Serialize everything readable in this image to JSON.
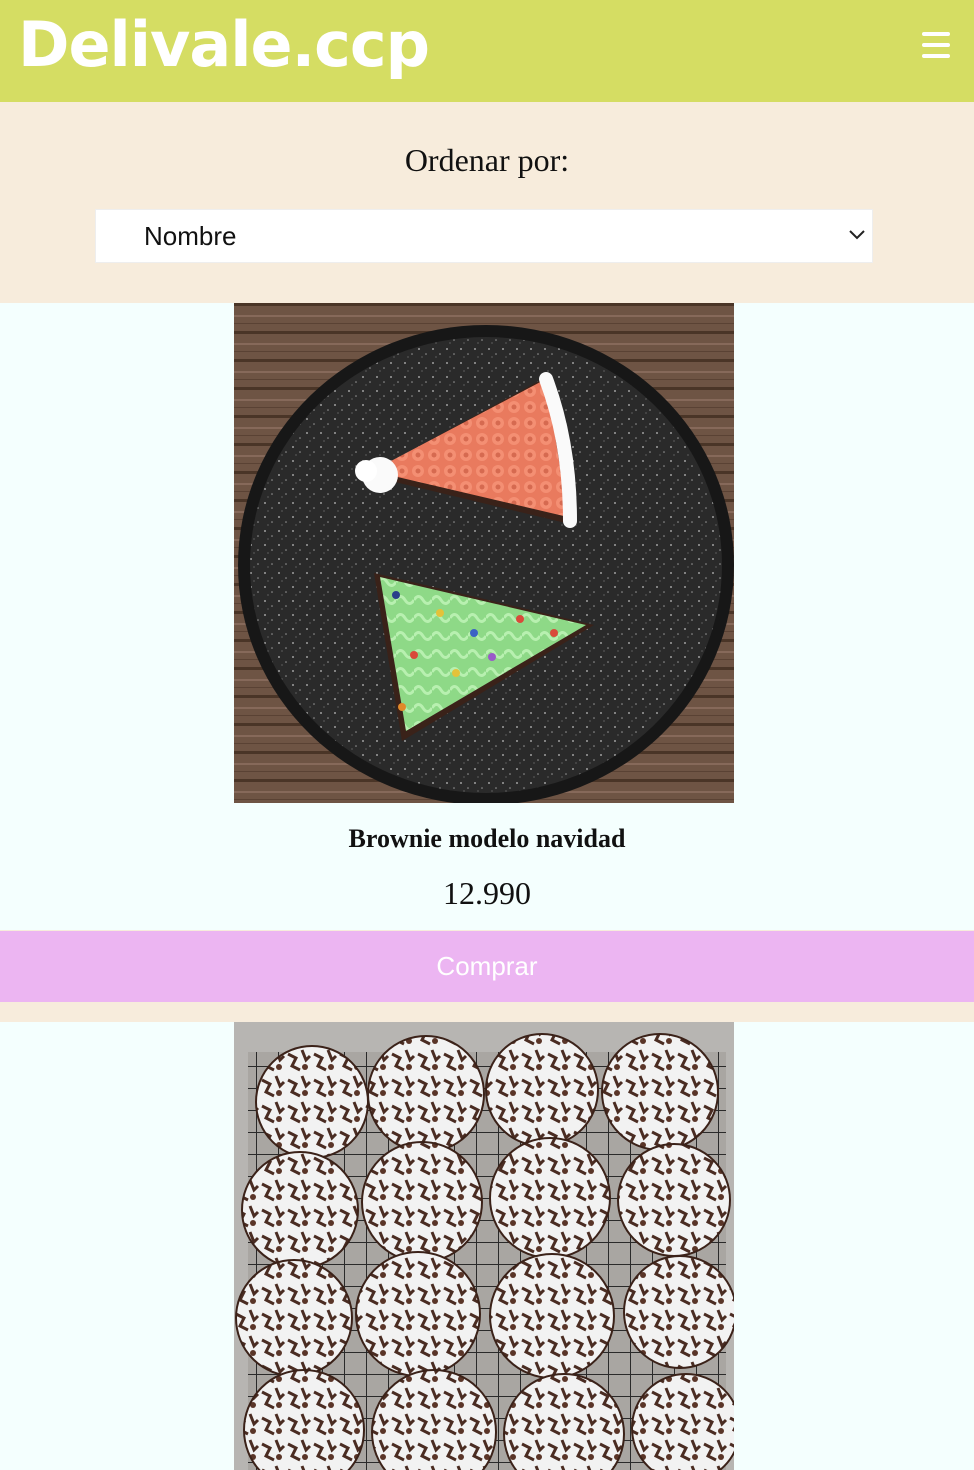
{
  "header": {
    "logo": "Delivale.ccp",
    "menu_icon": "hamburger-menu-icon",
    "background": "#d5dd63"
  },
  "sort": {
    "label": "Ordenar por:",
    "selected": "Nombre",
    "chevron_icon": "chevron-down-icon"
  },
  "products": [
    {
      "name": "Brownie modelo navidad",
      "price": "12.990",
      "buy_label": "Comprar",
      "image": "christmas-brownies-photo"
    },
    {
      "image": "crinkle-cookies-photo"
    }
  ],
  "colors": {
    "page_background": "#f7ecdc",
    "card_background": "#f4fffe",
    "buy_button": "#ecb5f2"
  }
}
